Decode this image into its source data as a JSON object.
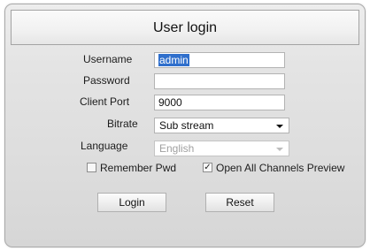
{
  "header": {
    "title": "User login"
  },
  "form": {
    "username": {
      "label": "Username",
      "value": "admin"
    },
    "password": {
      "label": "Password",
      "value": ""
    },
    "client_port": {
      "label": "Client Port",
      "value": "9000"
    },
    "bitrate": {
      "label": "Bitrate",
      "selected": "Sub stream"
    },
    "language": {
      "label": "Language",
      "selected": "English",
      "enabled": false
    }
  },
  "options": {
    "remember_pwd": {
      "label": "Remember Pwd",
      "checked": false
    },
    "open_all_channels": {
      "label": "Open All Channels Preview",
      "checked": true
    }
  },
  "buttons": {
    "login": "Login",
    "reset": "Reset"
  },
  "colors": {
    "selection": "#2f6fcc",
    "disabled_text": "#a0a0a0"
  }
}
